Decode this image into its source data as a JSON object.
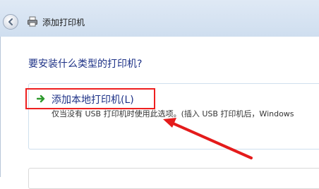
{
  "window": {
    "title": "添加打印机"
  },
  "page": {
    "heading": "要安装什么类型的打印机?"
  },
  "options": [
    {
      "title": "添加本地打印机(L)",
      "description": "仅当没有 USB 打印机时使用此选项。(插入 USB 打印机后，Windows"
    }
  ],
  "icons": {
    "back": "back-arrow-icon",
    "printer": "printer-icon",
    "option_arrow": "green-arrow-icon"
  },
  "colors": {
    "heading": "#1e3287",
    "highlight_box": "#ee1f1f",
    "annotation_arrow": "#e41b1b",
    "option_arrow": "#2e9a2e"
  }
}
